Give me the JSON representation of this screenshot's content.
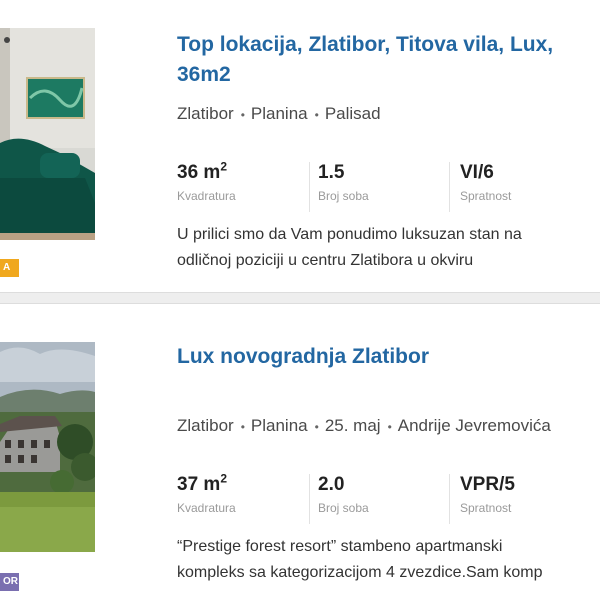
{
  "listings": [
    {
      "title": "Top lokacija, Zlatibor, Titova vila, Lux, 36m2",
      "location": [
        "Zlatibor",
        "Planina",
        "Palisad"
      ],
      "area_value": "36 m",
      "area_sup": "2",
      "area_label": "Kvadratura",
      "rooms_value": "1.5",
      "rooms_label": "Broj soba",
      "floor_value": "VI/6",
      "floor_label": "Spratnost",
      "desc_line1": "U prilici smo da Vam ponudimo luksuzan stan na",
      "desc_line2": "odličnoj poziciji u centru Zlatibora u okviru",
      "badge_text": "A",
      "badge_color": "#f0a81e"
    },
    {
      "title": "Lux novogradnja Zlatibor",
      "location": [
        "Zlatibor",
        "Planina",
        "25. maj",
        "Andrije Jevremovića"
      ],
      "area_value": "37 m",
      "area_sup": "2",
      "area_label": "Kvadratura",
      "rooms_value": "2.0",
      "rooms_label": "Broj soba",
      "floor_value": "VPR/5",
      "floor_label": "Spratnost",
      "desc_line1": "“Prestige forest resort” stambeno apartmanski",
      "desc_line2": "kompleks sa kategorizacijom 4 zvezdice.Sam komp",
      "badge_text": "OR",
      "badge_color": "#7a6fb0"
    }
  ],
  "colors": {
    "title": "#2367a2",
    "separator": "#eeeeee"
  }
}
